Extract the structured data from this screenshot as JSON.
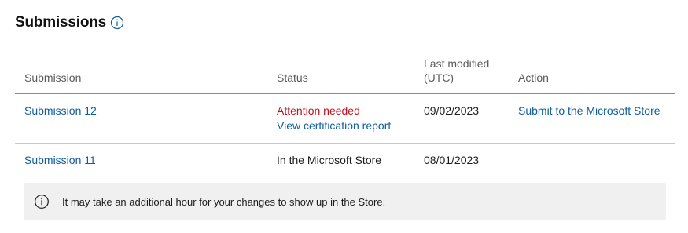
{
  "header": {
    "title": "Submissions",
    "info_icon": "info-circle-icon"
  },
  "table": {
    "columns": {
      "submission": "Submission",
      "status": "Status",
      "last_modified_line1": "Last modified",
      "last_modified_line2": "(UTC)",
      "action": "Action"
    },
    "rows": [
      {
        "submission": "Submission 12",
        "status": "Attention needed",
        "status_link": "View certification report",
        "last_modified": "09/02/2023",
        "action": "Submit to the Microsoft Store"
      },
      {
        "submission": "Submission 11",
        "status": "In the Microsoft Store",
        "last_modified": "08/01/2023"
      }
    ]
  },
  "notice": {
    "icon": "info-circle-icon",
    "text": "It may take an additional hour for your changes to show up in the Store."
  },
  "colors": {
    "link": "#0f5c9c",
    "attention": "#c50f1f",
    "notice_background": "#f0f0f0"
  }
}
